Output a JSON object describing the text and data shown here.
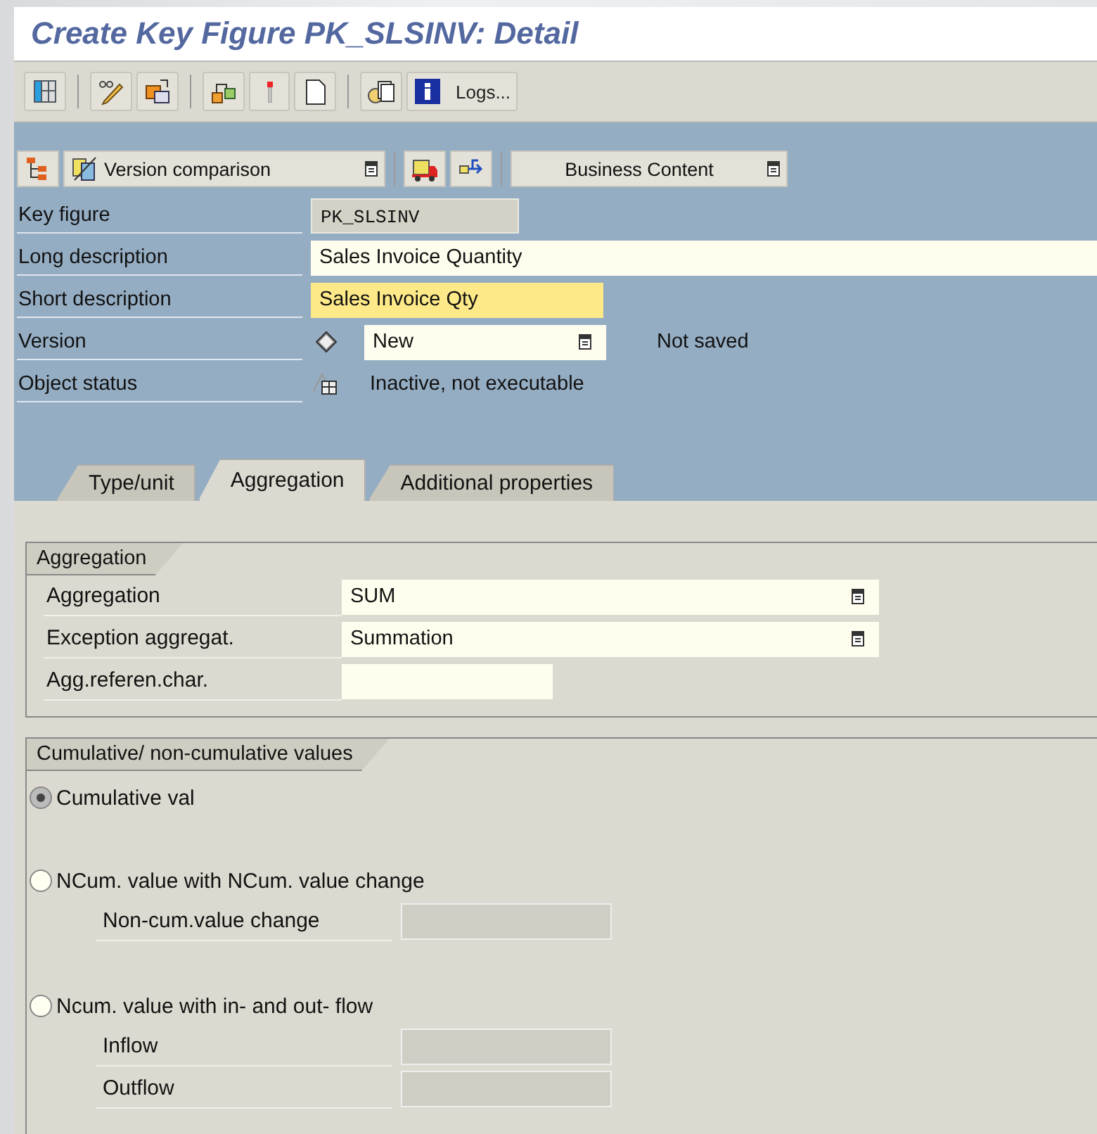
{
  "window": {
    "title": "Create Key Figure PK_SLSINV: Detail"
  },
  "toolbar": [
    {
      "kind": "grid"
    },
    {
      "kind": "separator"
    },
    {
      "kind": "pencil"
    },
    {
      "kind": "swap"
    },
    {
      "kind": "separator"
    },
    {
      "kind": "hierarchy"
    },
    {
      "kind": "wand"
    },
    {
      "kind": "page"
    },
    {
      "kind": "separator"
    },
    {
      "kind": "copy"
    },
    {
      "kind": "info",
      "label": "Logs..."
    }
  ],
  "app_toolbar": [
    {
      "kind": "tree"
    },
    {
      "kind": "menu-button",
      "label": "Version comparison"
    },
    {
      "kind": "separator"
    },
    {
      "kind": "truck"
    },
    {
      "kind": "transfer"
    },
    {
      "kind": "separator"
    },
    {
      "kind": "menu-button",
      "label": "Business Content"
    }
  ],
  "header_fields": [
    {
      "label": "Key figure",
      "kind": "display",
      "value": "PK_SLSINV"
    },
    {
      "label": "Long description",
      "kind": "input",
      "value": "Sales Invoice Quantity",
      "focused": false
    },
    {
      "label": "Short description",
      "kind": "input",
      "value": "Sales Invoice Qty",
      "focused": true
    },
    {
      "label": "Version",
      "kind": "dropdown",
      "value": "New",
      "note": "Not saved"
    },
    {
      "label": "Object status",
      "kind": "status",
      "value": "Inactive, not executable"
    }
  ],
  "tabs": [
    {
      "label": "Type/unit",
      "selected": false
    },
    {
      "label": "Aggregation",
      "selected": true
    },
    {
      "label": "Additional properties",
      "selected": false
    }
  ],
  "aggregation_group": {
    "title": "Aggregation",
    "fields": [
      {
        "label": "Aggregation",
        "kind": "dropdown",
        "value": "SUM"
      },
      {
        "label": "Exception aggregat.",
        "kind": "dropdown",
        "value": "Summation"
      },
      {
        "label": "Agg.referen.char.",
        "kind": "input"
      }
    ]
  },
  "cumulative_group": {
    "title": "Cumulative/ non-cumulative values",
    "options": [
      {
        "label": "Cumulative val",
        "selected": true
      },
      {
        "label": "NCum. value with NCum. value change",
        "selected": false,
        "fields": [
          {
            "label": "Non-cum.value change",
            "disabled": true
          }
        ]
      },
      {
        "label": "Ncum. value with in- and out- flow",
        "selected": false,
        "fields": [
          {
            "label": "Inflow",
            "disabled": true
          },
          {
            "label": "Outflow",
            "disabled": true
          }
        ]
      }
    ]
  }
}
